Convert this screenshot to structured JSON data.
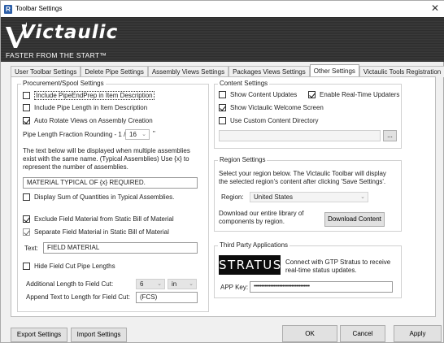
{
  "window": {
    "title": "Toolbar Settings",
    "app_icon": "R"
  },
  "banner": {
    "logo": "Victaulic",
    "tagline": "FASTER FROM THE START™"
  },
  "tabs": [
    {
      "label": "User Toolbar Settings"
    },
    {
      "label": "Delete Pipe Settings"
    },
    {
      "label": "Assembly Views Settings"
    },
    {
      "label": "Packages Views Settings"
    },
    {
      "label": "Other Settings"
    },
    {
      "label": "Victaulic Tools Registration"
    }
  ],
  "procurement": {
    "title": "Procurement/Spool Settings",
    "include_pipeendprep": "Include PipeEndPrep in Item Description",
    "include_pipe_length": "Include Pipe Length in Item Description",
    "auto_rotate": "Auto Rotate Views on Assembly Creation",
    "rounding_label": "Pipe Length Fraction Rounding - 1 /",
    "rounding_value": "16",
    "rounding_unit": "\"",
    "typical_desc_line1": "The text below will be displayed when multiple assemblies",
    "typical_desc_line2": "exist with the same name. (Typical Assemblies) Use {x} to",
    "typical_desc_line3": "represent the number of assemblies.",
    "typical_text": "MATERIAL TYPICAL OF {x} REQUIRED.",
    "display_sum": "Display Sum of Quantities in Typical Assemblies.",
    "exclude_field": "Exclude Field Material from Static Bill of Material",
    "separate_field": "Separate Field Material in Static Bill of Material",
    "text_label": "Text:",
    "text_value": "FIELD MATERIAL",
    "hide_cut": "Hide Field Cut Pipe Lengths",
    "additional_label": "Additional Length to Field Cut:",
    "additional_value": "6",
    "additional_unit": "in",
    "append_label": "Append Text to Length for Field Cut:",
    "append_value": "(FCS)"
  },
  "content": {
    "title": "Content Settings",
    "show_updates": "Show Content Updates",
    "realtime": "Enable Real-Time Updaters",
    "welcome": "Show Victaulic Welcome Screen",
    "custom_dir": "Use Custom Content Directory",
    "browse": "..."
  },
  "region": {
    "title": "Region Settings",
    "desc_line1": "Select your region below.  The Victaulic Toolbar will display",
    "desc_line2": "the selected region's content after clicking 'Save Settings'.",
    "label": "Region:",
    "value": "United States",
    "download_line1": "Download our entire library of",
    "download_line2": "components by region.",
    "download_button": "Download Content"
  },
  "thirdparty": {
    "title": "Third Party Applications",
    "logo": "STRATUS",
    "desc_line1": "Connect with GTP Stratus to receive",
    "desc_line2": "real-time status updates.",
    "key_label": "APP Key:",
    "key_value": "•••••••••••••••••••••••••••••••••••••"
  },
  "footer": {
    "export": "Export Settings",
    "import": "Import Settings",
    "ok": "OK",
    "cancel": "Cancel",
    "apply": "Apply"
  },
  "colors": {
    "banner_bg": "#333333",
    "logo_accent": "#ffffff",
    "app_icon": "#2d5fa8"
  }
}
